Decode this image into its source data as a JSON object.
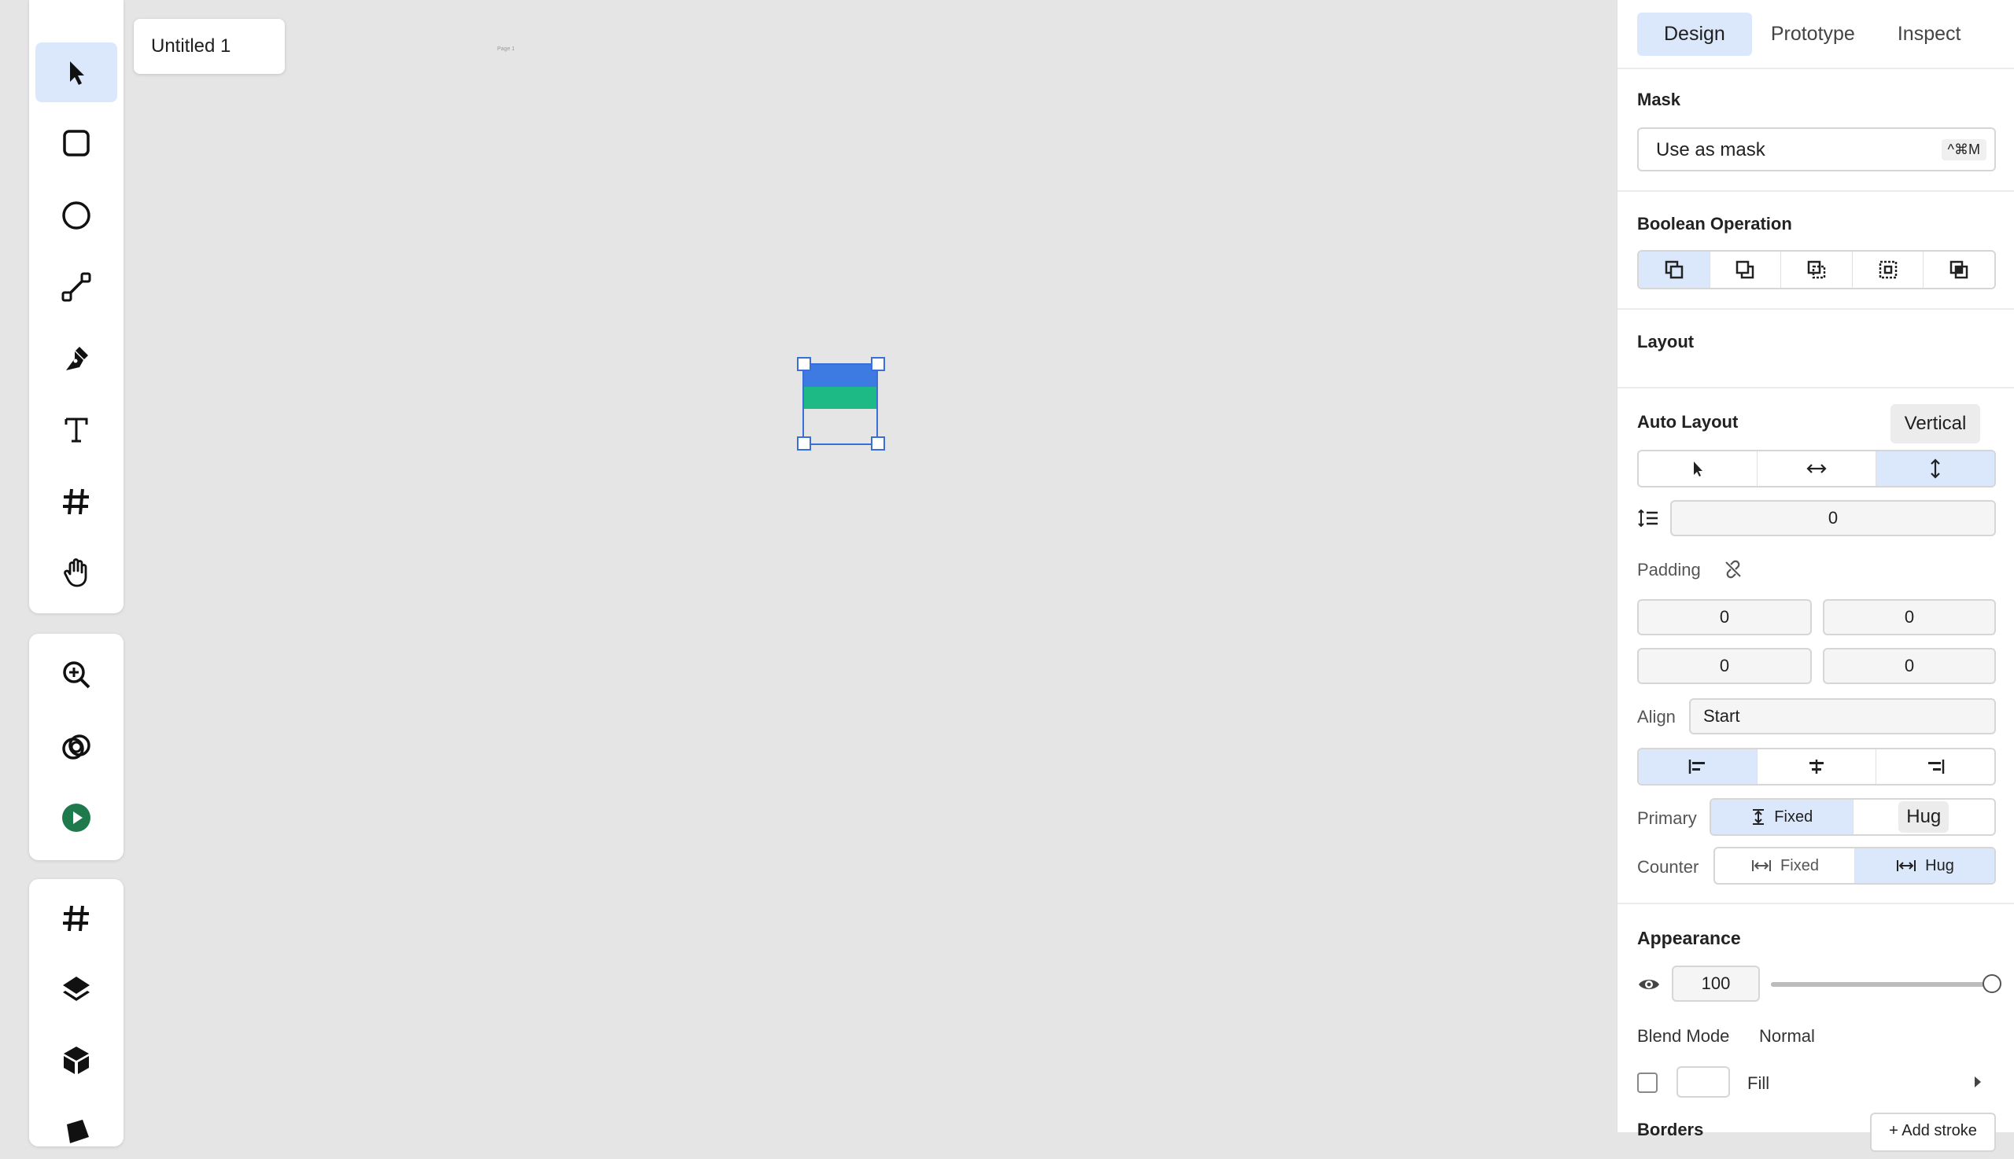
{
  "document": {
    "tab_title": "Untitled 1",
    "page_label": "Page 1"
  },
  "toolbar_main": [
    {
      "name": "select-tool",
      "icon": "cursor-icon",
      "active": true
    },
    {
      "name": "rectangle-tool",
      "icon": "rounded-square-icon"
    },
    {
      "name": "ellipse-tool",
      "icon": "circle-icon"
    },
    {
      "name": "line-tool",
      "icon": "line-icon"
    },
    {
      "name": "pen-tool",
      "icon": "pen-nib-icon"
    },
    {
      "name": "text-tool",
      "icon": "text-icon"
    },
    {
      "name": "frame-tool",
      "icon": "hash-icon"
    },
    {
      "name": "hand-tool",
      "icon": "hand-icon"
    }
  ],
  "toolbar_secondary": [
    {
      "name": "zoom-tool",
      "icon": "zoom-in-icon"
    },
    {
      "name": "boolean-tool",
      "icon": "overlap-circles-icon"
    },
    {
      "name": "play-tool",
      "icon": "play-circle-icon"
    }
  ],
  "toolbar_tertiary": [
    {
      "name": "frames-panel",
      "icon": "hash-icon"
    },
    {
      "name": "layers-panel",
      "icon": "layers-icon"
    },
    {
      "name": "components-panel",
      "icon": "cube-icon"
    }
  ],
  "panel": {
    "tabs": [
      {
        "label": "Design",
        "active": true
      },
      {
        "label": "Prototype",
        "active": false
      },
      {
        "label": "Inspect",
        "active": false
      }
    ],
    "mask": {
      "title": "Mask",
      "button_label": "Use as mask",
      "shortcut": "^⌘M"
    },
    "boolean": {
      "title": "Boolean Operation",
      "ops": [
        "union-icon",
        "subtract-icon",
        "intersect-icon",
        "exclude-icon",
        "flatten-icon"
      ]
    },
    "layout": {
      "title": "Layout"
    },
    "auto_layout": {
      "title": "Auto Layout",
      "tooltip": "Vertical",
      "direction_icons": [
        "pointer-icon",
        "horizontal-arrows-icon",
        "vertical-arrows-icon"
      ],
      "gap_value": "0",
      "padding_label": "Padding",
      "padding": [
        "0",
        "0",
        "0",
        "0"
      ],
      "align_label": "Align",
      "align_value": "Start",
      "primary_label": "Primary",
      "primary_fixed": "Fixed",
      "primary_hug": "Hug",
      "counter_label": "Counter",
      "counter_fixed": "Fixed",
      "counter_hug": "Hug"
    },
    "appearance": {
      "title": "Appearance",
      "opacity": "100",
      "opacity_level": 1.0,
      "blend_label": "Blend Mode",
      "blend_value": "Normal",
      "fill_label": "Fill"
    },
    "borders": {
      "title": "Borders",
      "add_label": "+ Add stroke"
    }
  },
  "colors": {
    "accent": "#3a6fd8",
    "selected_bg": "#dbe7fb",
    "shape_blue": "#3d7be3",
    "shape_green": "#1dba85",
    "play_green": "#1e7a4c"
  }
}
